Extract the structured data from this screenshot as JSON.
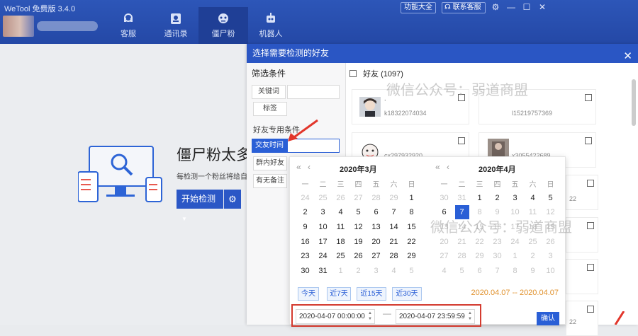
{
  "app": {
    "title": "WeTool 免费版 3.4.0"
  },
  "nav": [
    {
      "label": "客服",
      "icon": "headset-icon"
    },
    {
      "label": "通讯录",
      "icon": "contacts-icon"
    },
    {
      "label": "僵尸粉",
      "icon": "zombie-icon"
    },
    {
      "label": "机器人",
      "icon": "robot-icon"
    }
  ],
  "header_buttons": {
    "features": "功能大全",
    "service": "联系客服"
  },
  "background": {
    "title": "僵尸粉太多",
    "desc": "每检测一个粉丝将给自",
    "start_button": "开始检测"
  },
  "dialog": {
    "title": "选择需要检测的好友",
    "filter_title": "筛选条件",
    "keyword_btn": "关键词",
    "tag_btn": "标签",
    "friend_conditions": "好友专用条件",
    "time_btn": "交友时间",
    "group_btn": "群内好友",
    "note_btn": "有无备注",
    "friends_header": "好友 (1097)",
    "cards": [
      {
        "name": ".",
        "id": "k18322074034"
      },
      {
        "name": "",
        "id": "l15219757369"
      },
      {
        "name": "",
        "id": "cx297932920"
      },
      {
        "name": "",
        "id": "x3055422689"
      }
    ],
    "side_ids": [
      "22",
      "22"
    ]
  },
  "datepicker": {
    "left_month": "2020年3月",
    "right_month": "2020年4月",
    "weekdays": [
      "一",
      "二",
      "三",
      "四",
      "五",
      "六",
      "日"
    ],
    "left_days": [
      [
        "24",
        "25",
        "26",
        "27",
        "28",
        "29",
        "1"
      ],
      [
        "2",
        "3",
        "4",
        "5",
        "6",
        "7",
        "8"
      ],
      [
        "9",
        "10",
        "11",
        "12",
        "13",
        "14",
        "15"
      ],
      [
        "16",
        "17",
        "18",
        "19",
        "20",
        "21",
        "22"
      ],
      [
        "23",
        "24",
        "25",
        "26",
        "27",
        "28",
        "29"
      ],
      [
        "30",
        "31",
        "1",
        "2",
        "3",
        "4",
        "5"
      ]
    ],
    "right_days": [
      [
        "30",
        "31",
        "1",
        "2",
        "3",
        "4",
        "5"
      ],
      [
        "6",
        "7",
        "8",
        "9",
        "10",
        "11",
        "12"
      ],
      [
        "13",
        "14",
        "15",
        "16",
        "17",
        "18",
        "19"
      ],
      [
        "20",
        "21",
        "22",
        "23",
        "24",
        "25",
        "26"
      ],
      [
        "27",
        "28",
        "29",
        "30",
        "1",
        "2",
        "3"
      ],
      [
        "4",
        "5",
        "6",
        "7",
        "8",
        "9",
        "10"
      ]
    ],
    "quick": [
      "今天",
      "近7天",
      "近15天",
      "近30天"
    ],
    "range_text": "2020.04.07 -- 2020.04.07",
    "start_value": "2020-04-07 00:00:00",
    "end_value": "2020-04-07 23:59:59",
    "confirm": "确认"
  },
  "watermark": "微信公众号：弱道商盟"
}
